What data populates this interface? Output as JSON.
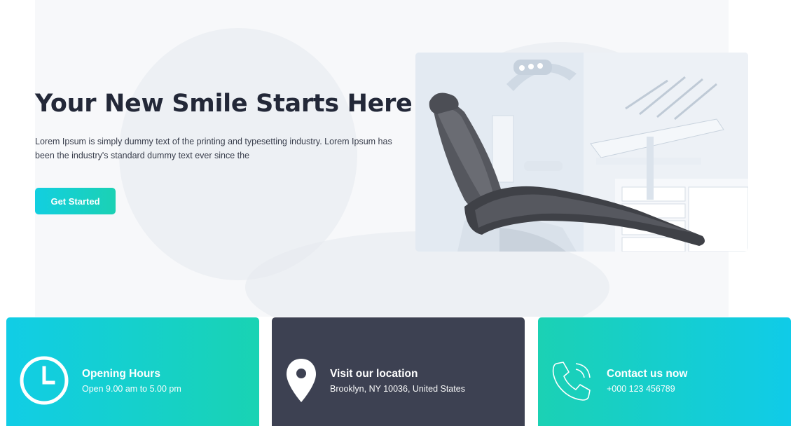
{
  "hero": {
    "title": "Your New Smile Starts Here",
    "description": "Lorem Ipsum is simply dummy text of the printing and typesetting industry. Lorem Ipsum has been the industry's standard dummy text ever since the",
    "cta_label": "Get Started"
  },
  "info_cards": [
    {
      "icon": "clock-icon",
      "title": "Opening Hours",
      "subtitle": "Open 9.00 am to 5.00 pm"
    },
    {
      "icon": "map-pin-icon",
      "title": "Visit our location",
      "subtitle": "Brooklyn, NY 10036, United States"
    },
    {
      "icon": "phone-icon",
      "title": "Contact us now",
      "subtitle": "+000 123 456789"
    }
  ],
  "colors": {
    "accent_cyan": "#12cfe0",
    "accent_teal": "#1bd1b4",
    "dark_card": "#3d4152",
    "heading": "#232838"
  }
}
